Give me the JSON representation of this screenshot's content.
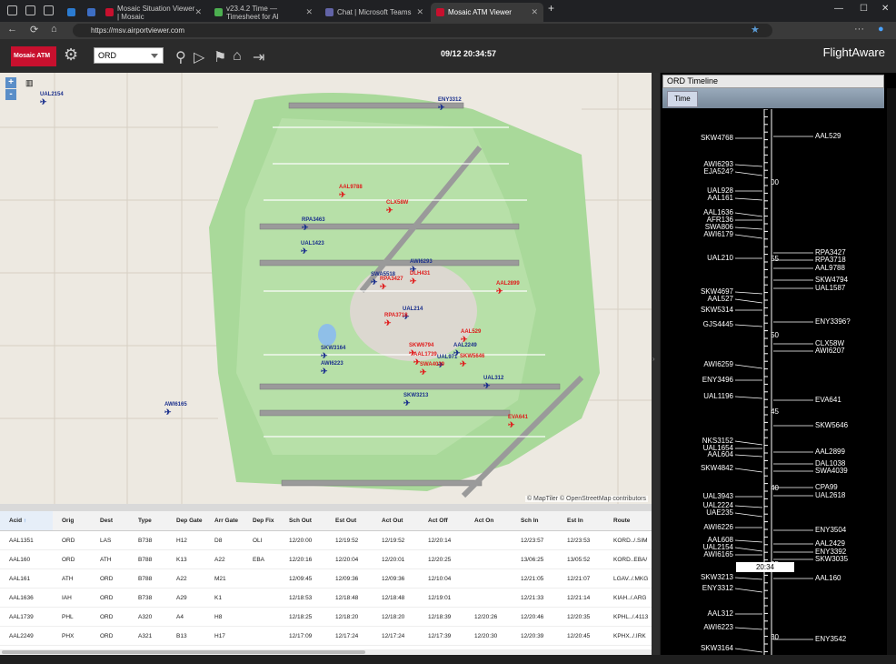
{
  "browser": {
    "tabs": [
      {
        "label": "",
        "color": "#2b7bd1"
      },
      {
        "label": "",
        "color": "#3d6ec4"
      },
      {
        "label": "Mosaic Situation Viewer | Mosaic",
        "color": "#c8102e"
      },
      {
        "label": "v23.4.2 Time — Timesheet for Al",
        "color": "#4caf50"
      },
      {
        "label": "Chat | Microsoft Teams",
        "color": "#6264a7"
      },
      {
        "label": "Mosaic ATM Viewer",
        "color": "#c8102e"
      }
    ],
    "url": "https://msv.airportviewer.com"
  },
  "header": {
    "logo_text": "Mosaic ATM",
    "airport": "ORD",
    "datetime": "09/12 20:34:57",
    "brand": "FlightAware"
  },
  "map": {
    "zoom_in": "+",
    "zoom_out": "-",
    "attribution": "© MapTiler © OpenStreetMap contributors",
    "aircraft": [
      {
        "id": "UAL2154",
        "type": "arr"
      },
      {
        "id": "ENY3312",
        "type": "arr"
      },
      {
        "id": "AAL9788",
        "type": "dep"
      },
      {
        "id": "CLX58W",
        "type": "dep"
      },
      {
        "id": "RPA3463",
        "type": "arr"
      },
      {
        "id": "UAL1423",
        "type": "arr"
      },
      {
        "id": "AWI6293",
        "type": "arr"
      },
      {
        "id": "DLH431",
        "type": "dep"
      },
      {
        "id": "SWA5518",
        "type": "arr"
      },
      {
        "id": "RPA3427",
        "type": "dep"
      },
      {
        "id": "AAL2899",
        "type": "dep"
      },
      {
        "id": "UAL214",
        "type": "arr"
      },
      {
        "id": "RPA3718",
        "type": "dep"
      },
      {
        "id": "AAL529",
        "type": "dep"
      },
      {
        "id": "SKW3164",
        "type": "arr"
      },
      {
        "id": "SKW6794",
        "type": "dep"
      },
      {
        "id": "AAL2249",
        "type": "arr"
      },
      {
        "id": "AAL1739",
        "type": "dep"
      },
      {
        "id": "UAL971",
        "type": "arr"
      },
      {
        "id": "SKW5646",
        "type": "dep"
      },
      {
        "id": "AWI6223",
        "type": "arr"
      },
      {
        "id": "SWA4039",
        "type": "dep"
      },
      {
        "id": "UAL312",
        "type": "arr"
      },
      {
        "id": "AWI6165",
        "type": "arr"
      },
      {
        "id": "SKW3213",
        "type": "arr"
      },
      {
        "id": "EVA641",
        "type": "dep"
      }
    ]
  },
  "grid": {
    "columns": [
      "Acid",
      "Orig",
      "Dest",
      "Type",
      "Dep Gate",
      "Arr Gate",
      "Dep Fix",
      "Sch Out",
      "Est Out",
      "Act Out",
      "Act Off",
      "Act On",
      "Sch In",
      "Est In",
      "Route"
    ],
    "rows": [
      [
        "AAL1351",
        "ORD",
        "LAS",
        "B738",
        "H12",
        "D8",
        "OLI",
        "12/20:00",
        "12/19:52",
        "12/19:52",
        "12/20:14",
        "",
        "12/23:57",
        "12/23:53",
        "KORD../.SIM"
      ],
      [
        "AAL160",
        "ORD",
        "ATH",
        "B788",
        "K13",
        "A22",
        "EBA",
        "12/20:16",
        "12/20:04",
        "12/20:01",
        "12/20:25",
        "",
        "13/06:25",
        "13/05:52",
        "KORD..EBA/"
      ],
      [
        "AAL161",
        "ATH",
        "ORD",
        "B788",
        "A22",
        "M21",
        "",
        "12/09:45",
        "12/09:36",
        "12/09:36",
        "12/10:04",
        "",
        "12/21:05",
        "12/21:07",
        "LGAV../.MKG"
      ],
      [
        "AAL1636",
        "IAH",
        "ORD",
        "B738",
        "A29",
        "K1",
        "",
        "12/18:53",
        "12/18:48",
        "12/18:48",
        "12/19:01",
        "",
        "12/21:33",
        "12/21:14",
        "KIAH../.ARG"
      ],
      [
        "AAL1739",
        "PHL",
        "ORD",
        "A320",
        "A4",
        "H8",
        "",
        "12/18:25",
        "12/18:20",
        "12/18:20",
        "12/18:39",
        "12/20:26",
        "12/20:46",
        "12/20:35",
        "KPHL../.4113"
      ],
      [
        "AAL2249",
        "PHX",
        "ORD",
        "A321",
        "B13",
        "H17",
        "",
        "12/17:09",
        "12/17:24",
        "12/17:24",
        "12/17:39",
        "12/20:30",
        "12/20:39",
        "12/20:45",
        "KPHX../.IRK"
      ]
    ]
  },
  "timeline": {
    "title": "ORD Timeline",
    "tab": "Time",
    "now": "20:34",
    "ticks": [
      "00",
      "55",
      "50",
      "45",
      "40",
      "35",
      "30"
    ],
    "left_labels": [
      "SKW4768",
      "AWI6293",
      "EJA524?",
      "UAL928",
      "AAL161",
      "AAL1636",
      "AFR136",
      "SWA806",
      "AWI6179",
      "UAL210",
      "SKW4697",
      "AAL527",
      "SKW5314",
      "GJS4445",
      "AWI6259",
      "ENY3496",
      "UAL1196",
      "NKS3152",
      "UAL1654",
      "AAL604",
      "SKW4842",
      "UAL3943",
      "UAL2224",
      "UAE235",
      "AWI6226",
      "AAL608",
      "UAL2154",
      "AWI6165",
      "SKW3213",
      "ENY3312",
      "AAL312",
      "AWI6223",
      "SKW3164"
    ],
    "right_labels": [
      "AAL529",
      "RPA3427",
      "RPA3718",
      "AAL9788",
      "SKW4794",
      "UAL1587",
      "ENY3396?",
      "CLX58W",
      "AWI6207",
      "EVA641",
      "SKW5646",
      "AAL2899",
      "DAL1038",
      "SWA4039",
      "CPA99",
      "UAL2618",
      "ENY3504",
      "AAL2429",
      "ENY3392",
      "SKW3035",
      "AAL160",
      "ENY3542"
    ]
  }
}
